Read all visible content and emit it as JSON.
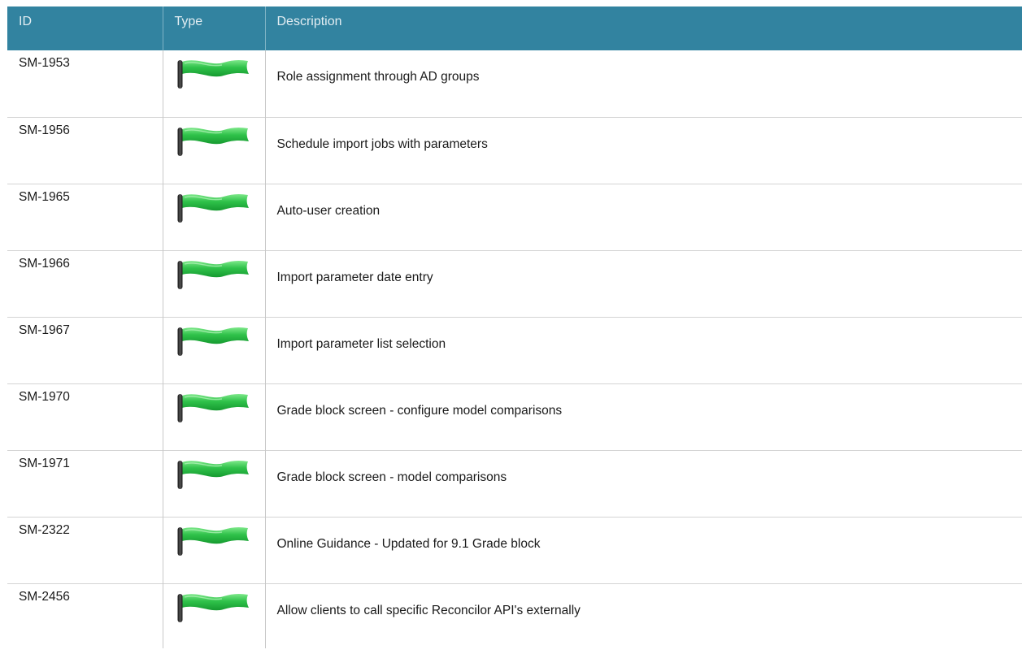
{
  "table": {
    "headers": {
      "id": "ID",
      "type": "Type",
      "description": "Description"
    },
    "rows": [
      {
        "id": "SM-1953",
        "type_icon": "green-flag-icon",
        "description": "Role assignment through AD groups"
      },
      {
        "id": "SM-1956",
        "type_icon": "green-flag-icon",
        "description": "Schedule import jobs with parameters"
      },
      {
        "id": "SM-1965",
        "type_icon": "green-flag-icon",
        "description": "Auto-user creation"
      },
      {
        "id": "SM-1966",
        "type_icon": "green-flag-icon",
        "description": "Import parameter date entry"
      },
      {
        "id": "SM-1967",
        "type_icon": "green-flag-icon",
        "description": "Import parameter list selection"
      },
      {
        "id": "SM-1970",
        "type_icon": "green-flag-icon",
        "description": "Grade block screen - configure model comparisons"
      },
      {
        "id": "SM-1971",
        "type_icon": "green-flag-icon",
        "description": "Grade block screen - model comparisons"
      },
      {
        "id": "SM-2322",
        "type_icon": "green-flag-icon",
        "description": "Online Guidance - Updated for 9.1 Grade block"
      },
      {
        "id": "SM-2456",
        "type_icon": "green-flag-icon",
        "description": "Allow clients to call specific Reconcilor API's externally"
      }
    ]
  },
  "colors": {
    "header_background": "#3283a0",
    "header_text": "#e2edf2",
    "flag_green": "#2fc24a",
    "pole_dark": "#333333"
  }
}
